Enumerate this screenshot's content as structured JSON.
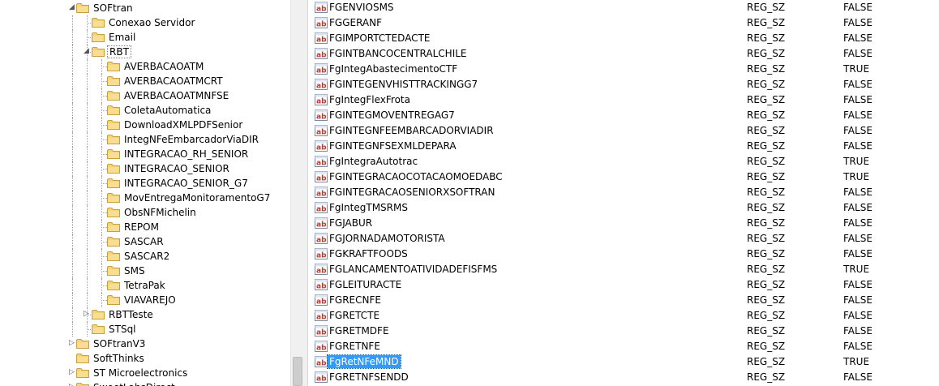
{
  "tree": {
    "nodes": [
      {
        "label": "SOFtran",
        "depth": 0,
        "state": "expanded",
        "has_children": true
      },
      {
        "label": "Conexao Servidor",
        "depth": 1,
        "state": "leaf",
        "has_children": false
      },
      {
        "label": "Email",
        "depth": 1,
        "state": "leaf",
        "has_children": false
      },
      {
        "label": "RBT",
        "depth": 1,
        "state": "expanded",
        "has_children": true,
        "focused": true
      },
      {
        "label": "AVERBACAOATM",
        "depth": 2,
        "state": "leaf",
        "has_children": false
      },
      {
        "label": "AVERBACAOATMCRT",
        "depth": 2,
        "state": "leaf",
        "has_children": false
      },
      {
        "label": "AVERBACAOATMNFSE",
        "depth": 2,
        "state": "leaf",
        "has_children": false
      },
      {
        "label": "ColetaAutomatica",
        "depth": 2,
        "state": "leaf",
        "has_children": false
      },
      {
        "label": "DownloadXMLPDFSenior",
        "depth": 2,
        "state": "leaf",
        "has_children": false
      },
      {
        "label": "IntegNFeEmbarcadorViaDIR",
        "depth": 2,
        "state": "leaf",
        "has_children": false
      },
      {
        "label": "INTEGRACAO_RH_SENIOR",
        "depth": 2,
        "state": "leaf",
        "has_children": false
      },
      {
        "label": "INTEGRACAO_SENIOR",
        "depth": 2,
        "state": "leaf",
        "has_children": false
      },
      {
        "label": "INTEGRACAO_SENIOR_G7",
        "depth": 2,
        "state": "leaf",
        "has_children": false
      },
      {
        "label": "MovEntregaMonitoramentoG7",
        "depth": 2,
        "state": "leaf",
        "has_children": false
      },
      {
        "label": "ObsNFMichelin",
        "depth": 2,
        "state": "leaf",
        "has_children": false
      },
      {
        "label": "REPOM",
        "depth": 2,
        "state": "leaf",
        "has_children": false
      },
      {
        "label": "SASCAR",
        "depth": 2,
        "state": "leaf",
        "has_children": false
      },
      {
        "label": "SASCAR2",
        "depth": 2,
        "state": "leaf",
        "has_children": false
      },
      {
        "label": "SMS",
        "depth": 2,
        "state": "leaf",
        "has_children": false
      },
      {
        "label": "TetraPak",
        "depth": 2,
        "state": "leaf",
        "has_children": false
      },
      {
        "label": "VIAVAREJO",
        "depth": 2,
        "state": "leaf",
        "has_children": false
      },
      {
        "label": "RBTTeste",
        "depth": 1,
        "state": "collapsed",
        "has_children": true
      },
      {
        "label": "STSql",
        "depth": 1,
        "state": "leaf",
        "has_children": false
      },
      {
        "label": "SOFtranV3",
        "depth": 0,
        "state": "collapsed",
        "has_children": true
      },
      {
        "label": "SoftThinks",
        "depth": 0,
        "state": "leaf",
        "has_children": false
      },
      {
        "label": "ST Microelectronics",
        "depth": 0,
        "state": "collapsed",
        "has_children": true
      },
      {
        "label": "SweetLabsDirect",
        "depth": 0,
        "state": "collapsed",
        "has_children": true
      }
    ]
  },
  "values": {
    "rows": [
      {
        "name": "FGENVIOSMS",
        "type": "REG_SZ",
        "data": "FALSE"
      },
      {
        "name": "FGGERANF",
        "type": "REG_SZ",
        "data": "FALSE"
      },
      {
        "name": "FGIMPORTCTEDACTE",
        "type": "REG_SZ",
        "data": "FALSE"
      },
      {
        "name": "FGINTBANCOCENTRALCHILE",
        "type": "REG_SZ",
        "data": "FALSE"
      },
      {
        "name": "FgIntegAbastecimentoCTF",
        "type": "REG_SZ",
        "data": "TRUE"
      },
      {
        "name": "FGINTEGENVHISTTRACKINGG7",
        "type": "REG_SZ",
        "data": "FALSE"
      },
      {
        "name": "FgIntegFlexFrota",
        "type": "REG_SZ",
        "data": "FALSE"
      },
      {
        "name": "FGINTEGMOVENTREGAG7",
        "type": "REG_SZ",
        "data": "FALSE"
      },
      {
        "name": "FGINTEGNFEEMBARCADORVIADIR",
        "type": "REG_SZ",
        "data": "FALSE"
      },
      {
        "name": "FGINTEGNFSEXMLDEPARA",
        "type": "REG_SZ",
        "data": "FALSE"
      },
      {
        "name": "FgIntegraAutotrac",
        "type": "REG_SZ",
        "data": "TRUE"
      },
      {
        "name": "FGINTEGRACAOCOTACAOMOEDABC",
        "type": "REG_SZ",
        "data": "TRUE"
      },
      {
        "name": "FGINTEGRACAOSENIORXSOFTRAN",
        "type": "REG_SZ",
        "data": "FALSE"
      },
      {
        "name": "FgIntegTMSRMS",
        "type": "REG_SZ",
        "data": "FALSE"
      },
      {
        "name": "FGJABUR",
        "type": "REG_SZ",
        "data": "FALSE"
      },
      {
        "name": "FGJORNADAMOTORISTA",
        "type": "REG_SZ",
        "data": "FALSE"
      },
      {
        "name": "FGKRAFTFOODS",
        "type": "REG_SZ",
        "data": "FALSE"
      },
      {
        "name": "FGLANCAMENTOATIVIDADEFISFMS",
        "type": "REG_SZ",
        "data": "TRUE"
      },
      {
        "name": "FGLEITURACTE",
        "type": "REG_SZ",
        "data": "FALSE"
      },
      {
        "name": "FGRECNFE",
        "type": "REG_SZ",
        "data": "FALSE"
      },
      {
        "name": "FGRETCTE",
        "type": "REG_SZ",
        "data": "FALSE"
      },
      {
        "name": "FGRETMDFE",
        "type": "REG_SZ",
        "data": "FALSE"
      },
      {
        "name": "FGRETNFE",
        "type": "REG_SZ",
        "data": "FALSE"
      },
      {
        "name": "FgRetNFeMND",
        "type": "REG_SZ",
        "data": "TRUE",
        "selected": true
      },
      {
        "name": "FGRETNFSENDD",
        "type": "REG_SZ",
        "data": "FALSE"
      }
    ]
  },
  "icons": {
    "folder": "folder-icon",
    "string_value": "reg-string-value-icon",
    "expanded": "expanded-arrow-icon",
    "collapsed": "collapsed-arrow-icon"
  },
  "colors": {
    "selection": "#3399ff",
    "folder_fill": "#f4d37a",
    "folder_edge": "#c9a13a",
    "string_icon_text": "#c0392b"
  }
}
